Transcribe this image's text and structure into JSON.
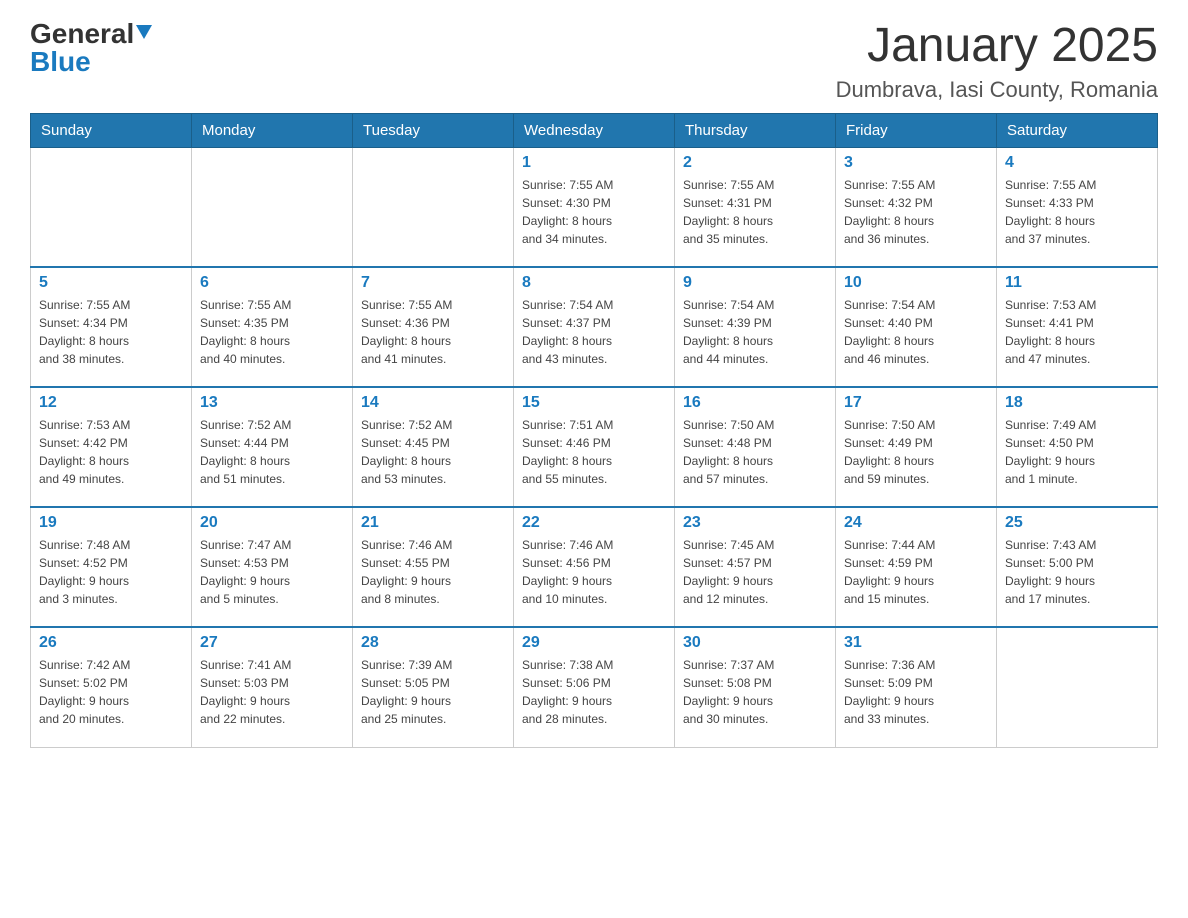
{
  "logo": {
    "general": "General",
    "blue": "Blue"
  },
  "header": {
    "month": "January 2025",
    "location": "Dumbrava, Iasi County, Romania"
  },
  "weekdays": [
    "Sunday",
    "Monday",
    "Tuesday",
    "Wednesday",
    "Thursday",
    "Friday",
    "Saturday"
  ],
  "weeks": [
    [
      {
        "day": "",
        "info": ""
      },
      {
        "day": "",
        "info": ""
      },
      {
        "day": "",
        "info": ""
      },
      {
        "day": "1",
        "info": "Sunrise: 7:55 AM\nSunset: 4:30 PM\nDaylight: 8 hours\nand 34 minutes."
      },
      {
        "day": "2",
        "info": "Sunrise: 7:55 AM\nSunset: 4:31 PM\nDaylight: 8 hours\nand 35 minutes."
      },
      {
        "day": "3",
        "info": "Sunrise: 7:55 AM\nSunset: 4:32 PM\nDaylight: 8 hours\nand 36 minutes."
      },
      {
        "day": "4",
        "info": "Sunrise: 7:55 AM\nSunset: 4:33 PM\nDaylight: 8 hours\nand 37 minutes."
      }
    ],
    [
      {
        "day": "5",
        "info": "Sunrise: 7:55 AM\nSunset: 4:34 PM\nDaylight: 8 hours\nand 38 minutes."
      },
      {
        "day": "6",
        "info": "Sunrise: 7:55 AM\nSunset: 4:35 PM\nDaylight: 8 hours\nand 40 minutes."
      },
      {
        "day": "7",
        "info": "Sunrise: 7:55 AM\nSunset: 4:36 PM\nDaylight: 8 hours\nand 41 minutes."
      },
      {
        "day": "8",
        "info": "Sunrise: 7:54 AM\nSunset: 4:37 PM\nDaylight: 8 hours\nand 43 minutes."
      },
      {
        "day": "9",
        "info": "Sunrise: 7:54 AM\nSunset: 4:39 PM\nDaylight: 8 hours\nand 44 minutes."
      },
      {
        "day": "10",
        "info": "Sunrise: 7:54 AM\nSunset: 4:40 PM\nDaylight: 8 hours\nand 46 minutes."
      },
      {
        "day": "11",
        "info": "Sunrise: 7:53 AM\nSunset: 4:41 PM\nDaylight: 8 hours\nand 47 minutes."
      }
    ],
    [
      {
        "day": "12",
        "info": "Sunrise: 7:53 AM\nSunset: 4:42 PM\nDaylight: 8 hours\nand 49 minutes."
      },
      {
        "day": "13",
        "info": "Sunrise: 7:52 AM\nSunset: 4:44 PM\nDaylight: 8 hours\nand 51 minutes."
      },
      {
        "day": "14",
        "info": "Sunrise: 7:52 AM\nSunset: 4:45 PM\nDaylight: 8 hours\nand 53 minutes."
      },
      {
        "day": "15",
        "info": "Sunrise: 7:51 AM\nSunset: 4:46 PM\nDaylight: 8 hours\nand 55 minutes."
      },
      {
        "day": "16",
        "info": "Sunrise: 7:50 AM\nSunset: 4:48 PM\nDaylight: 8 hours\nand 57 minutes."
      },
      {
        "day": "17",
        "info": "Sunrise: 7:50 AM\nSunset: 4:49 PM\nDaylight: 8 hours\nand 59 minutes."
      },
      {
        "day": "18",
        "info": "Sunrise: 7:49 AM\nSunset: 4:50 PM\nDaylight: 9 hours\nand 1 minute."
      }
    ],
    [
      {
        "day": "19",
        "info": "Sunrise: 7:48 AM\nSunset: 4:52 PM\nDaylight: 9 hours\nand 3 minutes."
      },
      {
        "day": "20",
        "info": "Sunrise: 7:47 AM\nSunset: 4:53 PM\nDaylight: 9 hours\nand 5 minutes."
      },
      {
        "day": "21",
        "info": "Sunrise: 7:46 AM\nSunset: 4:55 PM\nDaylight: 9 hours\nand 8 minutes."
      },
      {
        "day": "22",
        "info": "Sunrise: 7:46 AM\nSunset: 4:56 PM\nDaylight: 9 hours\nand 10 minutes."
      },
      {
        "day": "23",
        "info": "Sunrise: 7:45 AM\nSunset: 4:57 PM\nDaylight: 9 hours\nand 12 minutes."
      },
      {
        "day": "24",
        "info": "Sunrise: 7:44 AM\nSunset: 4:59 PM\nDaylight: 9 hours\nand 15 minutes."
      },
      {
        "day": "25",
        "info": "Sunrise: 7:43 AM\nSunset: 5:00 PM\nDaylight: 9 hours\nand 17 minutes."
      }
    ],
    [
      {
        "day": "26",
        "info": "Sunrise: 7:42 AM\nSunset: 5:02 PM\nDaylight: 9 hours\nand 20 minutes."
      },
      {
        "day": "27",
        "info": "Sunrise: 7:41 AM\nSunset: 5:03 PM\nDaylight: 9 hours\nand 22 minutes."
      },
      {
        "day": "28",
        "info": "Sunrise: 7:39 AM\nSunset: 5:05 PM\nDaylight: 9 hours\nand 25 minutes."
      },
      {
        "day": "29",
        "info": "Sunrise: 7:38 AM\nSunset: 5:06 PM\nDaylight: 9 hours\nand 28 minutes."
      },
      {
        "day": "30",
        "info": "Sunrise: 7:37 AM\nSunset: 5:08 PM\nDaylight: 9 hours\nand 30 minutes."
      },
      {
        "day": "31",
        "info": "Sunrise: 7:36 AM\nSunset: 5:09 PM\nDaylight: 9 hours\nand 33 minutes."
      },
      {
        "day": "",
        "info": ""
      }
    ]
  ]
}
